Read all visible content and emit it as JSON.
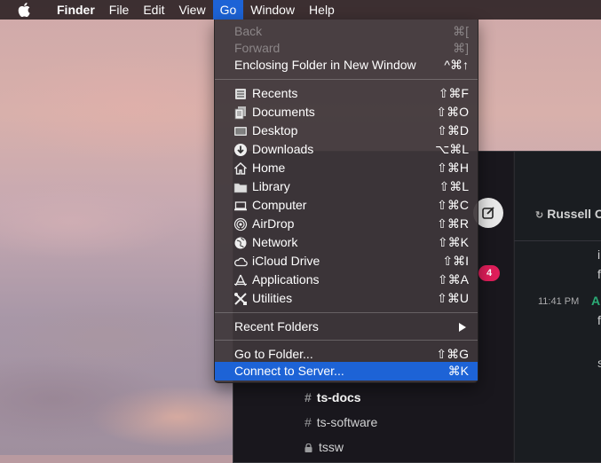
{
  "menubar": {
    "items": [
      {
        "label": "Finder"
      },
      {
        "label": "File"
      },
      {
        "label": "Edit"
      },
      {
        "label": "View"
      },
      {
        "label": "Go"
      },
      {
        "label": "Window"
      },
      {
        "label": "Help"
      }
    ]
  },
  "go_menu": {
    "back": {
      "label": "Back",
      "shortcut": "⌘["
    },
    "forward": {
      "label": "Forward",
      "shortcut": "⌘]"
    },
    "enclosing": {
      "label": "Enclosing Folder in New Window",
      "shortcut": "^⌘↑"
    },
    "places": [
      {
        "label": "Recents",
        "shortcut": "⇧⌘F",
        "icon": "recents-icon"
      },
      {
        "label": "Documents",
        "shortcut": "⇧⌘O",
        "icon": "documents-icon"
      },
      {
        "label": "Desktop",
        "shortcut": "⇧⌘D",
        "icon": "desktop-icon"
      },
      {
        "label": "Downloads",
        "shortcut": "⌥⌘L",
        "icon": "downloads-icon"
      },
      {
        "label": "Home",
        "shortcut": "⇧⌘H",
        "icon": "home-icon"
      },
      {
        "label": "Library",
        "shortcut": "⇧⌘L",
        "icon": "library-folder-icon"
      },
      {
        "label": "Computer",
        "shortcut": "⇧⌘C",
        "icon": "computer-icon"
      },
      {
        "label": "AirDrop",
        "shortcut": "⇧⌘R",
        "icon": "airdrop-icon"
      },
      {
        "label": "Network",
        "shortcut": "⇧⌘K",
        "icon": "network-icon"
      },
      {
        "label": "iCloud Drive",
        "shortcut": "⇧⌘I",
        "icon": "icloud-icon"
      },
      {
        "label": "Applications",
        "shortcut": "⇧⌘A",
        "icon": "applications-icon"
      },
      {
        "label": "Utilities",
        "shortcut": "⇧⌘U",
        "icon": "utilities-icon"
      }
    ],
    "recent_folders": {
      "label": "Recent Folders"
    },
    "go_to_folder": {
      "label": "Go to Folder...",
      "shortcut": "⇧⌘G"
    },
    "connect": {
      "label": "Connect to Server...",
      "shortcut": "⌘K"
    }
  },
  "background_app": {
    "header_user": "Russell O",
    "unread_badge": "4",
    "timestamp": "11:41 PM",
    "author_initial": "A",
    "snippet_chars": [
      "i",
      "f",
      "f",
      "S"
    ],
    "channels": [
      {
        "name": "ts-docs",
        "bold": true,
        "prefix": "#"
      },
      {
        "name": "ts-software",
        "bold": false,
        "prefix": "#"
      },
      {
        "name": "tssw",
        "bold": false,
        "prefix": "lock"
      }
    ]
  },
  "colors": {
    "highlight": "#1d63d6",
    "badge": "#e01e5a",
    "author": "#2bac76"
  }
}
